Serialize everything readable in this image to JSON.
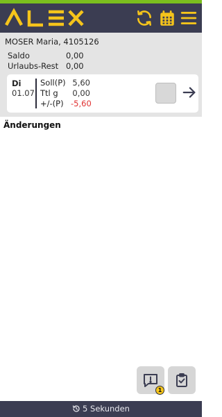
{
  "app": {
    "logo_text": "ALEX",
    "accent_color": "#f5c41b",
    "header_color": "#3b3d52",
    "topline_color": "#7bbf1e"
  },
  "header": {
    "icons": [
      "refresh-icon",
      "calendar-icon",
      "menu-icon"
    ]
  },
  "employee": {
    "name": "MOSER Maria, 4105126",
    "saldo_label": "Saldo",
    "saldo_value": "0,00",
    "urlaub_label": "Urlaubs-Rest",
    "urlaub_value": "0,00"
  },
  "day_card": {
    "day": "Di",
    "date": "01.07.",
    "rows": [
      {
        "label": "Soll(P)",
        "value": "5,60"
      },
      {
        "label": "Ttl g",
        "value": "0,00"
      },
      {
        "label": "+/-(P)",
        "value": "-5,60"
      }
    ],
    "negative_color": "#e03030",
    "checked": false
  },
  "changes": {
    "title": "Änderungen"
  },
  "actions": {
    "messages_icon": "message-alert-icon",
    "messages_badge": "1",
    "discard_icon": "clipboard-check-icon"
  },
  "footer": {
    "refresh_text": "5 Sekunden",
    "icon": "history-icon"
  }
}
